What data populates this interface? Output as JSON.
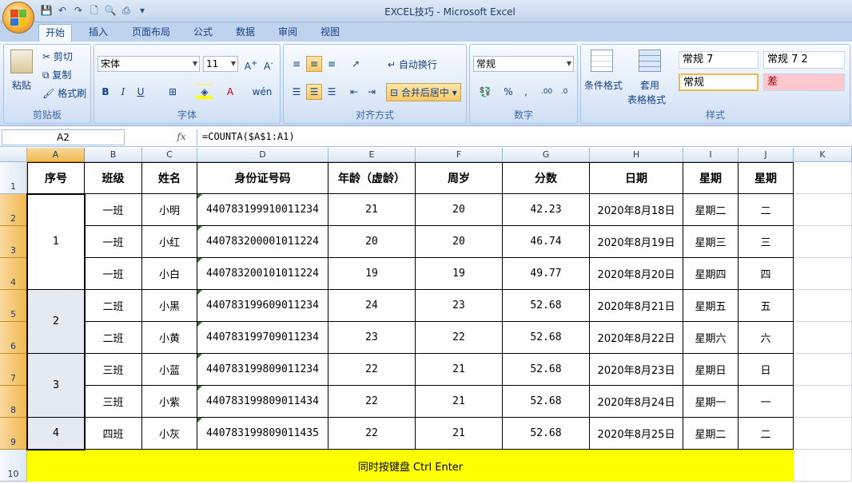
{
  "window": {
    "title": "EXCEL技巧 - Microsoft Excel"
  },
  "tabs": [
    "开始",
    "插入",
    "页面布局",
    "公式",
    "数据",
    "审阅",
    "视图"
  ],
  "ribbon": {
    "clipboard": {
      "paste": "粘贴",
      "cut": "剪切",
      "copy": "复制",
      "format_painter": "格式刷",
      "label": "剪贴板"
    },
    "font": {
      "name": "宋体",
      "size": "11",
      "label": "字体"
    },
    "alignment": {
      "wrap": "自动换行",
      "merge": "合并后居中",
      "label": "对齐方式"
    },
    "number": {
      "format": "常规",
      "label": "数字"
    },
    "styles": {
      "conditional": "条件格式",
      "table1": "套用",
      "table2": "表格格式",
      "s1": "常规 7",
      "s2": "常规 7 2",
      "s3": "常规",
      "s4": "差",
      "label": "样式"
    }
  },
  "formula_bar": {
    "name_box": "A2",
    "fx": "fx",
    "formula": "=COUNTA($A$1:A1)"
  },
  "columns": [
    "A",
    "B",
    "C",
    "D",
    "E",
    "F",
    "G",
    "H",
    "I",
    "J",
    "K"
  ],
  "rows": [
    "1",
    "2",
    "3",
    "4",
    "5",
    "6",
    "7",
    "8",
    "9",
    "10"
  ],
  "headers": [
    "序号",
    "班级",
    "姓名",
    "身份证号码",
    "年龄（虚龄）",
    "周岁",
    "分数",
    "日期",
    "星期",
    "星期"
  ],
  "merged_index": [
    "1",
    "2",
    "3",
    "4"
  ],
  "data_rows": [
    [
      "一班",
      "小明",
      "440783199910011234",
      "21",
      "20",
      "42.23",
      "2020年8月18日",
      "星期二",
      "二"
    ],
    [
      "一班",
      "小红",
      "440783200001011224",
      "20",
      "20",
      "46.74",
      "2020年8月19日",
      "星期三",
      "三"
    ],
    [
      "一班",
      "小白",
      "440783200101011224",
      "19",
      "19",
      "49.77",
      "2020年8月20日",
      "星期四",
      "四"
    ],
    [
      "二班",
      "小黑",
      "440783199609011234",
      "24",
      "23",
      "52.68",
      "2020年8月21日",
      "星期五",
      "五"
    ],
    [
      "二班",
      "小黄",
      "440783199709011234",
      "23",
      "22",
      "52.68",
      "2020年8月22日",
      "星期六",
      "六"
    ],
    [
      "三班",
      "小蓝",
      "440783199809011234",
      "22",
      "21",
      "52.68",
      "2020年8月23日",
      "星期日",
      "日"
    ],
    [
      "三班",
      "小紫",
      "440783199809011434",
      "22",
      "21",
      "52.68",
      "2020年8月24日",
      "星期一",
      "一"
    ],
    [
      "四班",
      "小灰",
      "440783199809011435",
      "22",
      "21",
      "52.68",
      "2020年8月25日",
      "星期二",
      "二"
    ]
  ],
  "banner": "同时按键盘 Ctrl Enter",
  "colors": {
    "banner": "#ffff00",
    "selected_header": "#f1b94e",
    "ribbon": "#d9e6f7"
  }
}
